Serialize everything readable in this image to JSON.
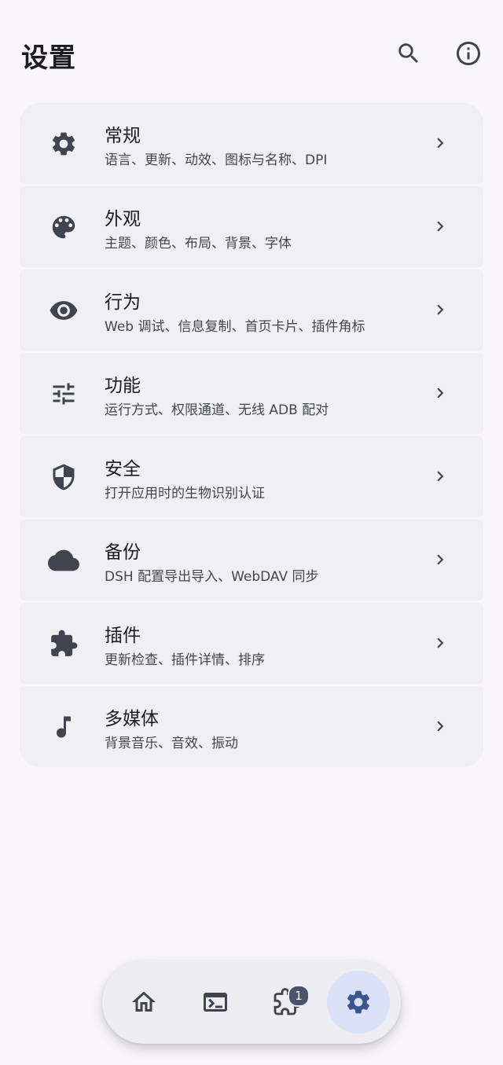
{
  "header": {
    "title": "设置",
    "actions": [
      {
        "icon": "search-icon"
      },
      {
        "icon": "info-icon"
      }
    ]
  },
  "settings": {
    "items": [
      {
        "icon": "gear-icon",
        "title": "常规",
        "subtitle": "语言、更新、动效、图标与名称、DPI"
      },
      {
        "icon": "palette-icon",
        "title": "外观",
        "subtitle": "主题、颜色、布局、背景、字体"
      },
      {
        "icon": "eye-icon",
        "title": "行为",
        "subtitle": "Web 调试、信息复制、首页卡片、插件角标"
      },
      {
        "icon": "sliders-icon",
        "title": "功能",
        "subtitle": "运行方式、权限通道、无线 ADB 配对"
      },
      {
        "icon": "shield-icon",
        "title": "安全",
        "subtitle": "打开应用时的生物识别认证"
      },
      {
        "icon": "cloud-icon",
        "title": "备份",
        "subtitle": "DSH 配置导出导入、WebDAV 同步"
      },
      {
        "icon": "puzzle-icon",
        "title": "插件",
        "subtitle": "更新检查、插件详情、排序"
      },
      {
        "icon": "music-note-icon",
        "title": "多媒体",
        "subtitle": "背景音乐、音效、振动"
      }
    ]
  },
  "nav": {
    "items": [
      {
        "icon": "home-icon",
        "active": false
      },
      {
        "icon": "terminal-icon",
        "active": false
      },
      {
        "icon": "puzzle-icon",
        "active": false,
        "badge": "1"
      },
      {
        "icon": "gear-icon",
        "active": true
      }
    ]
  },
  "colors": {
    "background": "#f8f5fc",
    "card": "#f0eff4",
    "icon": "#41444f",
    "nav_active": "#dbe2f7",
    "nav_active_icon": "#3b5592",
    "badge": "#49536b"
  }
}
